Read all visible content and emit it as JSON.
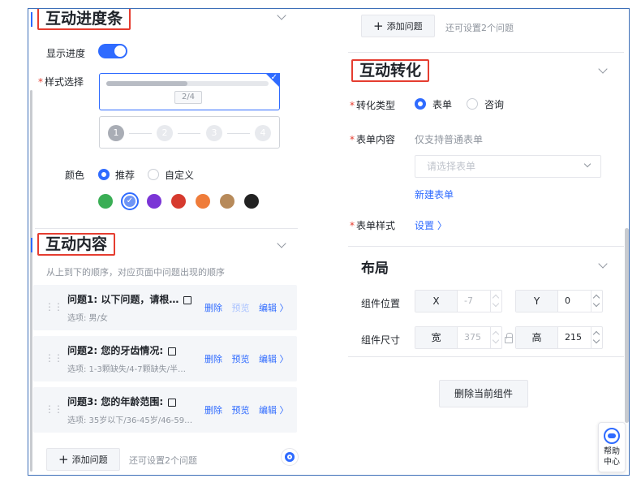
{
  "progress_section": {
    "title": "互动进度条",
    "show_progress_label": "显示进度",
    "show_progress_on": true,
    "style_label": "样式选择",
    "style_option_1_fraction": "2/4",
    "style_option_1_progress": 0.5,
    "style_option_2_steps": [
      "1",
      "2",
      "3",
      "4"
    ],
    "color_label": "颜色",
    "color_options": [
      {
        "label": "推荐",
        "selected": true
      },
      {
        "label": "自定义",
        "selected": false
      }
    ],
    "swatches": [
      "#3aae55",
      "#6f95f5",
      "#7b35d6",
      "#d63a2e",
      "#ef7c3a",
      "#b78a5a",
      "#222222"
    ],
    "selected_swatch_index": 1
  },
  "content_section": {
    "title": "互动内容",
    "hint": "从上到下的顺序，对应页面中问题出现的顺序",
    "questions": [
      {
        "title": "问题1: 以下问题，请根…",
        "options": "选项:  男/女",
        "delete": "删除",
        "preview": "预览",
        "edit": "编辑 〉",
        "preview_disabled": true
      },
      {
        "title": "问题2: 您的牙齿情况:",
        "options": "选项:  1-3颗缺失/4-7颗缺失/半…",
        "delete": "删除",
        "preview": "预览",
        "edit": "编辑 〉",
        "preview_disabled": false
      },
      {
        "title": "问题3: 您的年龄范围:",
        "options": "选项:  35岁以下/36-45岁/46-59…",
        "delete": "删除",
        "preview": "预览",
        "edit": "编辑 〉",
        "preview_disabled": false
      }
    ],
    "add_button": "添加问题",
    "add_hint": "还可设置2个问题"
  },
  "right_top": {
    "add_button": "添加问题",
    "add_hint": "还可设置2个问题"
  },
  "conversion_section": {
    "title": "互动转化",
    "type_label": "转化类型",
    "type_options": [
      {
        "label": "表单",
        "selected": true
      },
      {
        "label": "咨询",
        "selected": false
      }
    ],
    "form_content_label": "表单内容",
    "form_content_hint": "仅支持普通表单",
    "form_select_placeholder": "请选择表单",
    "new_form_link": "新建表单",
    "form_style_label": "表单样式",
    "form_style_link": "设置 〉"
  },
  "layout_section": {
    "title": "布局",
    "position_label": "组件位置",
    "x_key": "X",
    "x_value": "-7",
    "y_key": "Y",
    "y_value": "0",
    "size_label": "组件尺寸",
    "w_key": "宽",
    "w_value": "375",
    "h_key": "高",
    "h_value": "215"
  },
  "delete_component_button": "删除当前组件",
  "help": {
    "line1": "帮助",
    "line2": "中心"
  }
}
